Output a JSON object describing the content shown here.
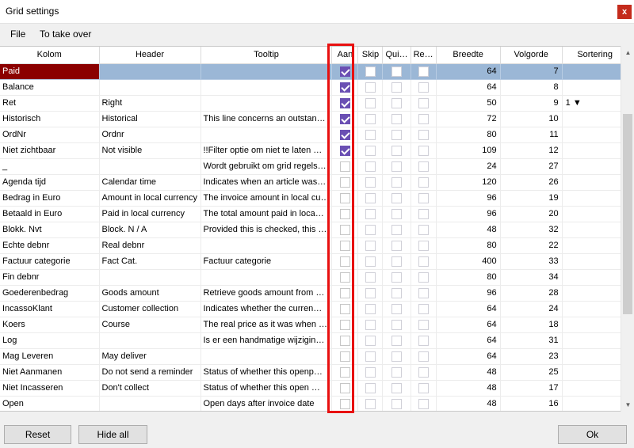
{
  "window": {
    "title": "Grid settings",
    "close_label": "x"
  },
  "menu": {
    "file": "File",
    "take_over": "To take over"
  },
  "columns": [
    "Kolom",
    "Header",
    "Tooltip",
    "Aan",
    "Skip",
    "Qui…",
    "Re…",
    "Breedte",
    "Volgorde",
    "Sortering"
  ],
  "rows": [
    {
      "kolom": "Paid",
      "header": "",
      "tooltip": "",
      "aan": true,
      "skip": false,
      "qui": false,
      "re": false,
      "breedte": "64",
      "volgorde": "7",
      "sortering": ""
    },
    {
      "kolom": "Balance",
      "header": "",
      "tooltip": "",
      "aan": true,
      "skip": false,
      "qui": false,
      "re": false,
      "breedte": "64",
      "volgorde": "8",
      "sortering": ""
    },
    {
      "kolom": "Ret",
      "header": "Right",
      "tooltip": "",
      "aan": true,
      "skip": false,
      "qui": false,
      "re": false,
      "breedte": "50",
      "volgorde": "9",
      "sortering": "1 ▼"
    },
    {
      "kolom": "Historisch",
      "header": "Historical",
      "tooltip": "This line concerns an outstan…",
      "aan": true,
      "skip": false,
      "qui": false,
      "re": false,
      "breedte": "72",
      "volgorde": "10",
      "sortering": ""
    },
    {
      "kolom": "OrdNr",
      "header": "Ordnr",
      "tooltip": "",
      "aan": true,
      "skip": false,
      "qui": false,
      "re": false,
      "breedte": "80",
      "volgorde": "11",
      "sortering": ""
    },
    {
      "kolom": "Niet zichtbaar",
      "header": "Not visible",
      "tooltip": "!!Filter optie om niet te laten …",
      "aan": true,
      "skip": false,
      "qui": false,
      "re": false,
      "breedte": "109",
      "volgorde": "12",
      "sortering": ""
    },
    {
      "kolom": "_",
      "header": "",
      "tooltip": "Wordt gebruikt om grid regels…",
      "aan": false,
      "skip": false,
      "qui": false,
      "re": false,
      "breedte": "24",
      "volgorde": "27",
      "sortering": ""
    },
    {
      "kolom": "Agenda tijd",
      "header": "Calendar time",
      "tooltip": "Indicates when an article was…",
      "aan": false,
      "skip": false,
      "qui": false,
      "re": false,
      "breedte": "120",
      "volgorde": "26",
      "sortering": ""
    },
    {
      "kolom": "Bedrag in Euro",
      "header": "Amount in local currency",
      "tooltip": "The invoice amount in local cu…",
      "aan": false,
      "skip": false,
      "qui": false,
      "re": false,
      "breedte": "96",
      "volgorde": "19",
      "sortering": ""
    },
    {
      "kolom": "Betaald in Euro",
      "header": "Paid in local currency",
      "tooltip": "The total amount paid in loca…",
      "aan": false,
      "skip": false,
      "qui": false,
      "re": false,
      "breedte": "96",
      "volgorde": "20",
      "sortering": ""
    },
    {
      "kolom": "Blokk. Nvt",
      "header": "Block. N / A",
      "tooltip": "Provided this is checked, this …",
      "aan": false,
      "skip": false,
      "qui": false,
      "re": false,
      "breedte": "48",
      "volgorde": "32",
      "sortering": ""
    },
    {
      "kolom": "Echte debnr",
      "header": "Real debnr",
      "tooltip": "",
      "aan": false,
      "skip": false,
      "qui": false,
      "re": false,
      "breedte": "80",
      "volgorde": "22",
      "sortering": ""
    },
    {
      "kolom": "Factuur categorie",
      "header": "Fact Cat.",
      "tooltip": "Factuur categorie",
      "aan": false,
      "skip": false,
      "qui": false,
      "re": false,
      "breedte": "400",
      "volgorde": "33",
      "sortering": ""
    },
    {
      "kolom": "Fin debnr",
      "header": "",
      "tooltip": "",
      "aan": false,
      "skip": false,
      "qui": false,
      "re": false,
      "breedte": "80",
      "volgorde": "34",
      "sortering": ""
    },
    {
      "kolom": "Goederenbedrag",
      "header": "Goods amount",
      "tooltip": "Retrieve goods amount from …",
      "aan": false,
      "skip": false,
      "qui": false,
      "re": false,
      "breedte": "96",
      "volgorde": "28",
      "sortering": ""
    },
    {
      "kolom": "IncassoKlant",
      "header": "Customer collection",
      "tooltip": "Indicates whether the curren…",
      "aan": false,
      "skip": false,
      "qui": false,
      "re": false,
      "breedte": "64",
      "volgorde": "24",
      "sortering": ""
    },
    {
      "kolom": "Koers",
      "header": "Course",
      "tooltip": "The real price as it was when …",
      "aan": false,
      "skip": false,
      "qui": false,
      "re": false,
      "breedte": "64",
      "volgorde": "18",
      "sortering": ""
    },
    {
      "kolom": "Log",
      "header": "",
      "tooltip": "Is er een handmatige wijzigin…",
      "aan": false,
      "skip": false,
      "qui": false,
      "re": false,
      "breedte": "64",
      "volgorde": "31",
      "sortering": ""
    },
    {
      "kolom": "Mag Leveren",
      "header": "May deliver",
      "tooltip": "",
      "aan": false,
      "skip": false,
      "qui": false,
      "re": false,
      "breedte": "64",
      "volgorde": "23",
      "sortering": ""
    },
    {
      "kolom": "Niet Aanmanen",
      "header": "Do not send a reminder",
      "tooltip": "Status of whether this openp…",
      "aan": false,
      "skip": false,
      "qui": false,
      "re": false,
      "breedte": "48",
      "volgorde": "25",
      "sortering": ""
    },
    {
      "kolom": "Niet Incasseren",
      "header": "Don't collect",
      "tooltip": "Status of whether this open …",
      "aan": false,
      "skip": false,
      "qui": false,
      "re": false,
      "breedte": "48",
      "volgorde": "17",
      "sortering": ""
    },
    {
      "kolom": "Open",
      "header": "",
      "tooltip": "Open days after invoice date",
      "aan": false,
      "skip": false,
      "qui": false,
      "re": false,
      "breedte": "48",
      "volgorde": "16",
      "sortering": ""
    }
  ],
  "buttons": {
    "reset": "Reset",
    "hide_all": "Hide all",
    "ok": "Ok"
  },
  "colors": {
    "selected_row": "#9bb7d6",
    "selected_key_cell": "#8b0000",
    "checkbox_on": "#6a4fb3",
    "highlight_box": "#e81010"
  }
}
